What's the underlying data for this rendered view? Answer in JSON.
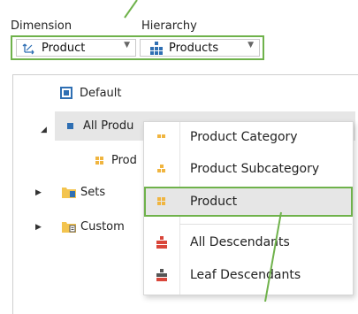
{
  "toolbar": {
    "dimension_label": "Dimension",
    "hierarchy_label": "Hierarchy",
    "dimension_value": "Product",
    "hierarchy_value": "Products"
  },
  "tree": {
    "default_label": "Default",
    "all_products_label": "All Produ",
    "product_child_label": "Prod",
    "sets_label": "Sets",
    "custom_label": "Custom"
  },
  "menu": {
    "items": [
      {
        "label": "Product Category",
        "icon": "level-icon"
      },
      {
        "label": "Product Subcategory",
        "icon": "level-icon"
      },
      {
        "label": "Product",
        "icon": "level-icon",
        "highlighted": true
      },
      {
        "label": "All Descendants",
        "icon": "hierarchy-red-icon"
      },
      {
        "label": "Leaf Descendants",
        "icon": "hierarchy-dark-icon"
      }
    ]
  },
  "colors": {
    "accent_green": "#6fb24b",
    "level_orange": "#f0b540",
    "hierarchy_blue": "#2f6fb3",
    "descendants_red": "#d9463a"
  }
}
